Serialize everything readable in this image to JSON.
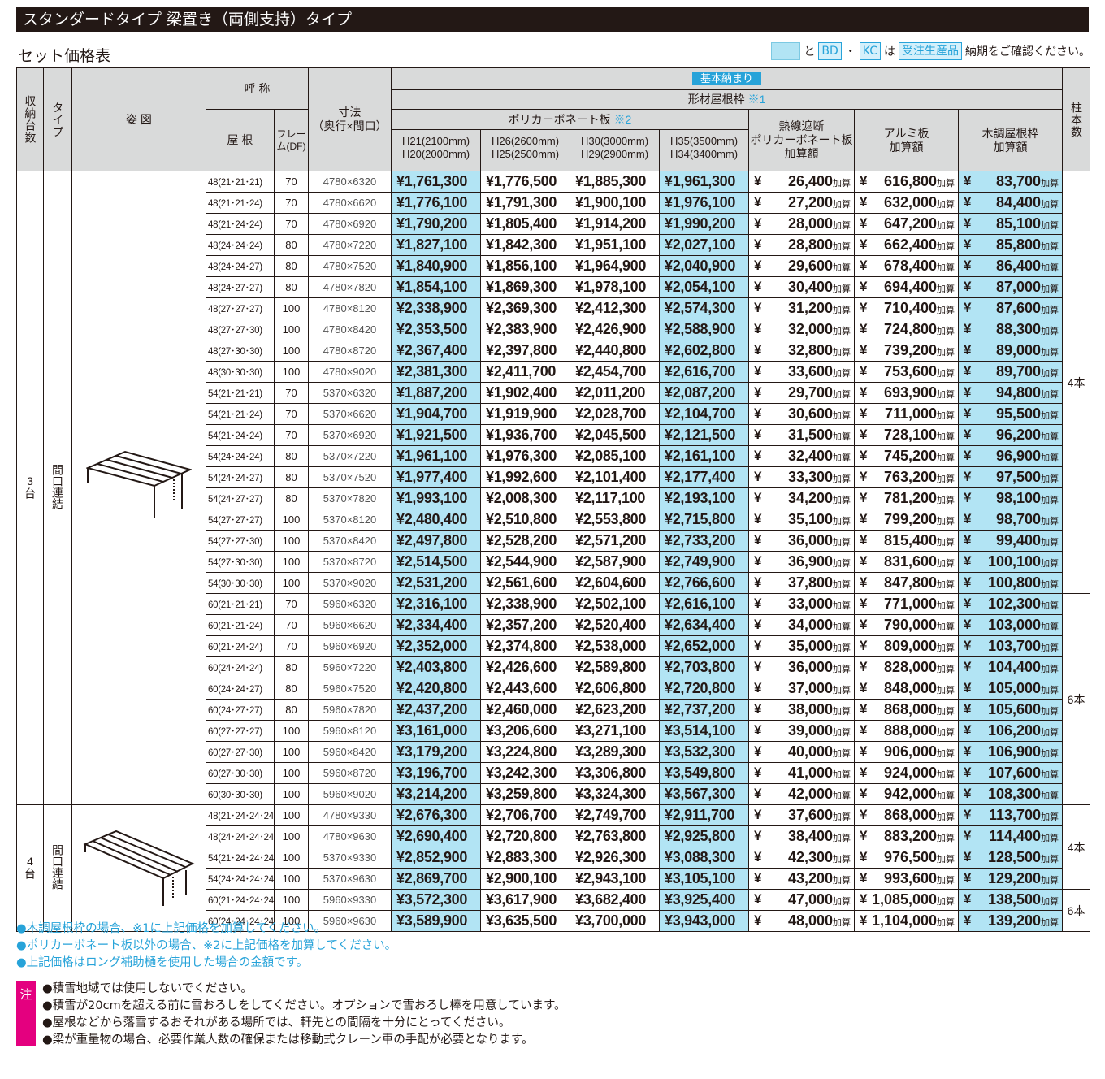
{
  "title": "スタンダードタイプ 梁置き（両側支持）タイプ",
  "subtitle": "セット価格表",
  "legend": {
    "to": "と",
    "bd": "BD",
    "dot": "・",
    "kc": "KC",
    "ha": "は",
    "made_to_order": "受注生産品",
    "confirm": "納期をご確認ください。"
  },
  "colors": {
    "highlight": "#b2e4f4",
    "accent": "#27a3d9",
    "caution": "#e4007f",
    "header_bg": "#d9dada"
  },
  "header": {
    "storage": "収納台数",
    "type": "タイプ",
    "figure": "姿 図",
    "name": "呼 称",
    "roof": "屋 根",
    "frame": "フレーム(DF)",
    "size": "寸法",
    "size_sub": "（奥行×間口）",
    "basic": "基本納まり",
    "frame_roof": "形材屋根枠",
    "frame_roof_note": "※1",
    "poly": "ポリカーボネート板",
    "poly_note": "※2",
    "h21": "H21(2100mm)",
    "h20": "H20(2000mm)",
    "h26": "H26(2600mm)",
    "h25": "H25(2500mm)",
    "h30": "H30(3000mm)",
    "h29": "H29(2900mm)",
    "h35": "H35(3500mm)",
    "h34": "H34(3400mm)",
    "heat1": "熱線遮断",
    "heat2": "ポリカーボネート板",
    "heat3": "加算額",
    "alu1": "アルミ板",
    "alu2": "加算額",
    "wood1": "木調屋根枠",
    "wood2": "加算額",
    "posts": "柱本数"
  },
  "groups": [
    {
      "count": "3台",
      "type": "間口連結"
    },
    {
      "count": "4台",
      "type": "間口連結"
    }
  ],
  "posts_labels": [
    "4本",
    "6本",
    "4本",
    "6本"
  ],
  "add_label": "加算",
  "yen": "¥",
  "rows": [
    [
      "48(21･21･21)",
      "70",
      "4780×6320",
      "¥1,761,300",
      "¥1,776,500",
      "¥1,885,300",
      "¥1,961,300",
      "26,400",
      "616,800",
      "83,700"
    ],
    [
      "48(21･21･24)",
      "70",
      "4780×6620",
      "¥1,776,100",
      "¥1,791,300",
      "¥1,900,100",
      "¥1,976,100",
      "27,200",
      "632,000",
      "84,400"
    ],
    [
      "48(21･24･24)",
      "70",
      "4780×6920",
      "¥1,790,200",
      "¥1,805,400",
      "¥1,914,200",
      "¥1,990,200",
      "28,000",
      "647,200",
      "85,100"
    ],
    [
      "48(24･24･24)",
      "80",
      "4780×7220",
      "¥1,827,100",
      "¥1,842,300",
      "¥1,951,100",
      "¥2,027,100",
      "28,800",
      "662,400",
      "85,800"
    ],
    [
      "48(24･24･27)",
      "80",
      "4780×7520",
      "¥1,840,900",
      "¥1,856,100",
      "¥1,964,900",
      "¥2,040,900",
      "29,600",
      "678,400",
      "86,400"
    ],
    [
      "48(24･27･27)",
      "80",
      "4780×7820",
      "¥1,854,100",
      "¥1,869,300",
      "¥1,978,100",
      "¥2,054,100",
      "30,400",
      "694,400",
      "87,000"
    ],
    [
      "48(27･27･27)",
      "100",
      "4780×8120",
      "¥2,338,900",
      "¥2,369,300",
      "¥2,412,300",
      "¥2,574,300",
      "31,200",
      "710,400",
      "87,600"
    ],
    [
      "48(27･27･30)",
      "100",
      "4780×8420",
      "¥2,353,500",
      "¥2,383,900",
      "¥2,426,900",
      "¥2,588,900",
      "32,000",
      "724,800",
      "88,300"
    ],
    [
      "48(27･30･30)",
      "100",
      "4780×8720",
      "¥2,367,400",
      "¥2,397,800",
      "¥2,440,800",
      "¥2,602,800",
      "32,800",
      "739,200",
      "89,000"
    ],
    [
      "48(30･30･30)",
      "100",
      "4780×9020",
      "¥2,381,300",
      "¥2,411,700",
      "¥2,454,700",
      "¥2,616,700",
      "33,600",
      "753,600",
      "89,700"
    ],
    [
      "54(21･21･21)",
      "70",
      "5370×6320",
      "¥1,887,200",
      "¥1,902,400",
      "¥2,011,200",
      "¥2,087,200",
      "29,700",
      "693,900",
      "94,800"
    ],
    [
      "54(21･21･24)",
      "70",
      "5370×6620",
      "¥1,904,700",
      "¥1,919,900",
      "¥2,028,700",
      "¥2,104,700",
      "30,600",
      "711,000",
      "95,500"
    ],
    [
      "54(21･24･24)",
      "70",
      "5370×6920",
      "¥1,921,500",
      "¥1,936,700",
      "¥2,045,500",
      "¥2,121,500",
      "31,500",
      "728,100",
      "96,200"
    ],
    [
      "54(24･24･24)",
      "80",
      "5370×7220",
      "¥1,961,100",
      "¥1,976,300",
      "¥2,085,100",
      "¥2,161,100",
      "32,400",
      "745,200",
      "96,900"
    ],
    [
      "54(24･24･27)",
      "80",
      "5370×7520",
      "¥1,977,400",
      "¥1,992,600",
      "¥2,101,400",
      "¥2,177,400",
      "33,300",
      "763,200",
      "97,500"
    ],
    [
      "54(24･27･27)",
      "80",
      "5370×7820",
      "¥1,993,100",
      "¥2,008,300",
      "¥2,117,100",
      "¥2,193,100",
      "34,200",
      "781,200",
      "98,100"
    ],
    [
      "54(27･27･27)",
      "100",
      "5370×8120",
      "¥2,480,400",
      "¥2,510,800",
      "¥2,553,800",
      "¥2,715,800",
      "35,100",
      "799,200",
      "98,700"
    ],
    [
      "54(27･27･30)",
      "100",
      "5370×8420",
      "¥2,497,800",
      "¥2,528,200",
      "¥2,571,200",
      "¥2,733,200",
      "36,000",
      "815,400",
      "99,400"
    ],
    [
      "54(27･30･30)",
      "100",
      "5370×8720",
      "¥2,514,500",
      "¥2,544,900",
      "¥2,587,900",
      "¥2,749,900",
      "36,900",
      "831,600",
      "100,100"
    ],
    [
      "54(30･30･30)",
      "100",
      "5370×9020",
      "¥2,531,200",
      "¥2,561,600",
      "¥2,604,600",
      "¥2,766,600",
      "37,800",
      "847,800",
      "100,800"
    ],
    [
      "60(21･21･21)",
      "70",
      "5960×6320",
      "¥2,316,100",
      "¥2,338,900",
      "¥2,502,100",
      "¥2,616,100",
      "33,000",
      "771,000",
      "102,300"
    ],
    [
      "60(21･21･24)",
      "70",
      "5960×6620",
      "¥2,334,400",
      "¥2,357,200",
      "¥2,520,400",
      "¥2,634,400",
      "34,000",
      "790,000",
      "103,000"
    ],
    [
      "60(21･24･24)",
      "70",
      "5960×6920",
      "¥2,352,000",
      "¥2,374,800",
      "¥2,538,000",
      "¥2,652,000",
      "35,000",
      "809,000",
      "103,700"
    ],
    [
      "60(24･24･24)",
      "80",
      "5960×7220",
      "¥2,403,800",
      "¥2,426,600",
      "¥2,589,800",
      "¥2,703,800",
      "36,000",
      "828,000",
      "104,400"
    ],
    [
      "60(24･24･27)",
      "80",
      "5960×7520",
      "¥2,420,800",
      "¥2,443,600",
      "¥2,606,800",
      "¥2,720,800",
      "37,000",
      "848,000",
      "105,000"
    ],
    [
      "60(24･27･27)",
      "80",
      "5960×7820",
      "¥2,437,200",
      "¥2,460,000",
      "¥2,623,200",
      "¥2,737,200",
      "38,000",
      "868,000",
      "105,600"
    ],
    [
      "60(27･27･27)",
      "100",
      "5960×8120",
      "¥3,161,000",
      "¥3,206,600",
      "¥3,271,100",
      "¥3,514,100",
      "39,000",
      "888,000",
      "106,200"
    ],
    [
      "60(27･27･30)",
      "100",
      "5960×8420",
      "¥3,179,200",
      "¥3,224,800",
      "¥3,289,300",
      "¥3,532,300",
      "40,000",
      "906,000",
      "106,900"
    ],
    [
      "60(27･30･30)",
      "100",
      "5960×8720",
      "¥3,196,700",
      "¥3,242,300",
      "¥3,306,800",
      "¥3,549,800",
      "41,000",
      "924,000",
      "107,600"
    ],
    [
      "60(30･30･30)",
      "100",
      "5960×9020",
      "¥3,214,200",
      "¥3,259,800",
      "¥3,324,300",
      "¥3,567,300",
      "42,000",
      "942,000",
      "108,300"
    ],
    [
      "48(21･24･24･24)",
      "100",
      "4780×9330",
      "¥2,676,300",
      "¥2,706,700",
      "¥2,749,700",
      "¥2,911,700",
      "37,600",
      "868,000",
      "113,700"
    ],
    [
      "48(24･24･24･24)",
      "100",
      "4780×9630",
      "¥2,690,400",
      "¥2,720,800",
      "¥2,763,800",
      "¥2,925,800",
      "38,400",
      "883,200",
      "114,400"
    ],
    [
      "54(21･24･24･24)",
      "100",
      "5370×9330",
      "¥2,852,900",
      "¥2,883,300",
      "¥2,926,300",
      "¥3,088,300",
      "42,300",
      "976,500",
      "128,500"
    ],
    [
      "54(24･24･24･24)",
      "100",
      "5370×9630",
      "¥2,869,700",
      "¥2,900,100",
      "¥2,943,100",
      "¥3,105,100",
      "43,200",
      "993,600",
      "129,200"
    ],
    [
      "60(21･24･24･24)",
      "100",
      "5960×9330",
      "¥3,572,300",
      "¥3,617,900",
      "¥3,682,400",
      "¥3,925,400",
      "47,000",
      "1,085,000",
      "138,500"
    ],
    [
      "60(24･24･24･24)",
      "100",
      "5960×9630",
      "¥3,589,900",
      "¥3,635,500",
      "¥3,700,000",
      "¥3,943,000",
      "48,000",
      "1,104,000",
      "139,200"
    ]
  ],
  "notes": [
    "●木調屋根枠の場合、※1に上記価格を加算してください。",
    "●ポリカーボネート板以外の場合、※2に上記価格を加算してください。",
    "●上記価格はロング補助樋を使用した場合の金額です。"
  ],
  "caution": {
    "badge": "注",
    "lines": [
      "●積雪地域では使用しないでください。",
      "●積雪が20cmを超える前に雪おろしをしてください。オプションで雪おろし棒を用意しています。",
      "●屋根などから落雪するおそれがある場所では、軒先との間隔を十分にとってください。",
      "●梁が重量物の場合、必要作業人数の確保または移動式クレーン車の手配が必要となります。"
    ]
  }
}
